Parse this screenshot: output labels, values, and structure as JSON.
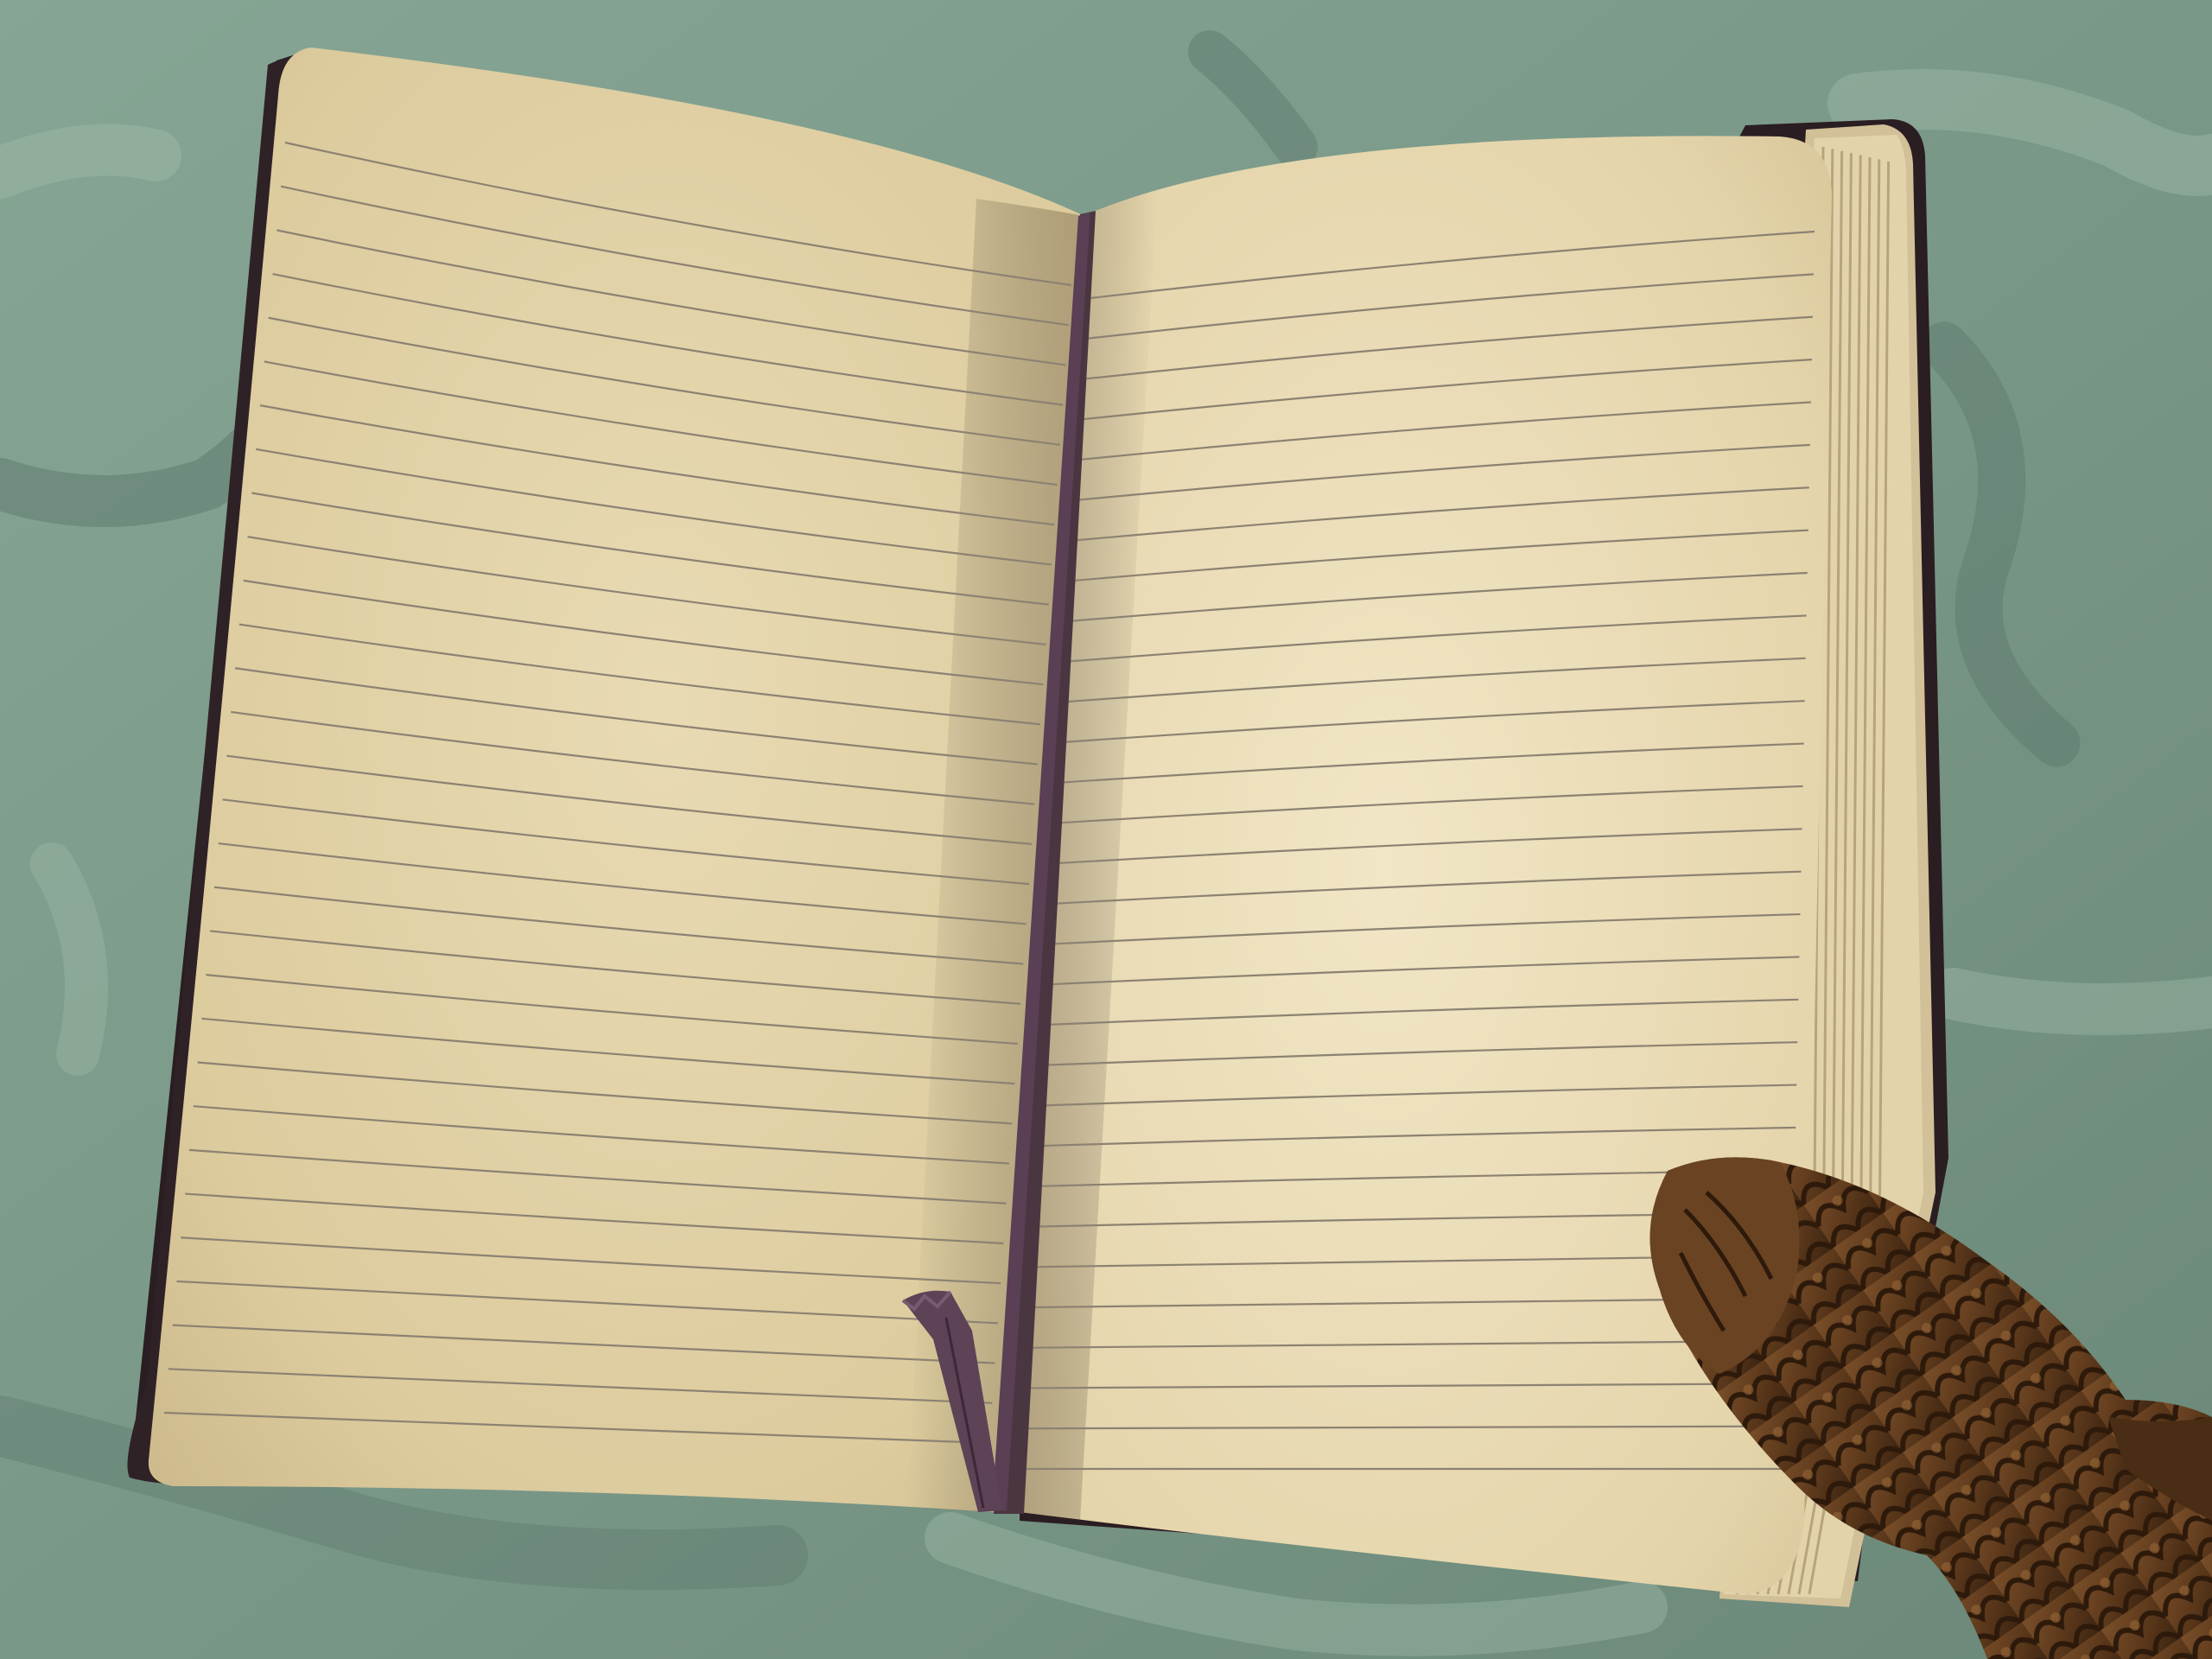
{
  "scene": {
    "subject": "open-ruled-notebook",
    "elements": [
      "fabric-background",
      "notebook-cover",
      "left-page",
      "right-page",
      "page-stack",
      "bookmark-ribbon",
      "carved-wooden-fish"
    ]
  },
  "colors": {
    "fabric_light": "#8aa897",
    "fabric_mid": "#6f8c80",
    "fabric_shadow": "#4f6a60",
    "cover": "#2a1e22",
    "page_light": "#e9dcb8",
    "page_mid": "#dccb9f",
    "page_shade": "#c9b587",
    "rule_line": "#8c8272",
    "ribbon": "#5a3f55",
    "wood_light": "#8a5a2e",
    "wood_dark": "#3e2612"
  },
  "notebook": {
    "ruled_lines_left_page": 30,
    "ruled_lines_right_page": 30
  }
}
